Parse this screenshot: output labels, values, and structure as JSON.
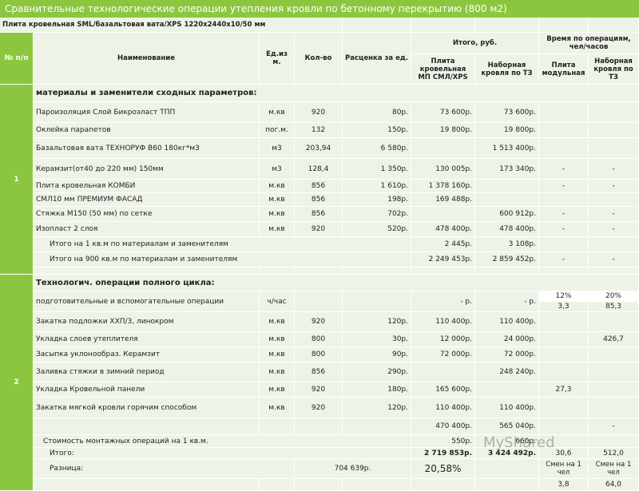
{
  "title": "Сравнительные технологические операции утепления кровли по бетонному перекрытию (800 м2)",
  "subtitle": "Плита кровельная SML/базальтовая вата/XPS 1220x2440x10/50 мм",
  "headers": {
    "num": "№ п/п",
    "name": "Наименование",
    "unit": "Ед.из м.",
    "qty": "Кол-во",
    "price": "Расценка за ед.",
    "total_group": "Итого, руб.",
    "time_group": "Время по операциям, чел/часов",
    "total_sml": "Плита кровельная МП СМЛ/XPS",
    "total_tz": "Наборная кровля по ТЗ",
    "time_mod": "Плита модульная",
    "time_tz": "Наборная кровля по ТЗ"
  },
  "section1": {
    "num": "1",
    "title": "материалы и заменители сходных параметров:",
    "rows": [
      {
        "name": "Пароизоляция Слой Бикроэласт ТПП",
        "unit": "м.кв",
        "qty": "920",
        "price": "80р.",
        "total_sml": "73 600р.",
        "total_tz": "73 600р.",
        "t1": "",
        "t2": ""
      },
      {
        "name": "Оклейка парапетов",
        "unit": "пог.м.",
        "qty": "132",
        "price": "150р.",
        "total_sml": "19 800р.",
        "total_tz": "19 800р.",
        "t1": "",
        "t2": ""
      },
      {
        "name": "Базальтовая вата ТЕХНОРУФ В60 180кг*м3",
        "unit": "м3",
        "qty": "203,94",
        "price": "6 580р.",
        "total_sml": "",
        "total_tz": "1 513 400р.",
        "t1": "",
        "t2": ""
      },
      {
        "name": "Керамзит(от40 до 220 мм) 150мм",
        "unit": "м3",
        "qty": "128,4",
        "price": "1 350р.",
        "total_sml": "130 005р.",
        "total_tz": "173 340р.",
        "t1": "-",
        "t2": "-"
      },
      {
        "name": "Плита кровельная КОМБИ",
        "unit": "м.кв",
        "qty": "856",
        "price": "1 610р.",
        "total_sml": "1 378 160р.",
        "total_tz": "",
        "t1": "-",
        "t2": "-"
      },
      {
        "name": "СМЛ10 мм ПРЕМИУМ ФАСАД",
        "unit": "м.кв",
        "qty": "856",
        "price": "198р.",
        "total_sml": "169 488р.",
        "total_tz": "",
        "t1": "",
        "t2": ""
      },
      {
        "name": "Стяжка М150 (50 мм) по сетке",
        "unit": "м.кв",
        "qty": "856",
        "price": "702р.",
        "total_sml": "",
        "total_tz": "600 912р.",
        "t1": "-",
        "t2": "-"
      },
      {
        "name": "Изопласт 2 слоя",
        "unit": "м.кв",
        "qty": "920",
        "price": "520р.",
        "total_sml": "478 400р.",
        "total_tz": "478 400р.",
        "t1": "-",
        "t2": "-"
      }
    ],
    "sum1": {
      "label": "Итого на 1 кв.м по материалам и заменителям",
      "total_sml": "2 445р.",
      "total_tz": "3 108р."
    },
    "sum2": {
      "label": "Итого на 900 кв.м по материалам и заменителям",
      "total_sml": "2 249 453р.",
      "total_tz": "2 859 452р.",
      "t1": "-",
      "t2": "-"
    }
  },
  "section2": {
    "num": "2",
    "title": "Технологич. операции полного цикла:",
    "prep": {
      "name": "подготовительные и вспомогательные операции",
      "unit": "ч/час",
      "total_sml": "- р.",
      "total_tz": "- р.",
      "pct1": "12%",
      "pct2": "20%",
      "val1": "3,3",
      "val2": "85,3"
    },
    "rows": [
      {
        "name": "Закатка подложки ХХП/3, линокром",
        "unit": "м.кв",
        "qty": "920",
        "price": "120р.",
        "total_sml": "110 400р.",
        "total_tz": "110 400р.",
        "t1": "",
        "t2": ""
      },
      {
        "name": "Укладка слоев утеплителя",
        "unit": "м.кв",
        "qty": "800",
        "price": "30р.",
        "total_sml": "12 000р.",
        "total_tz": "24 000р.",
        "t1": "",
        "t2": "426,7"
      },
      {
        "name": "Засыпка уклонообраз. Керамзит",
        "unit": "м.кв",
        "qty": "800",
        "price": "90р.",
        "total_sml": "72 000р.",
        "total_tz": "72 000р.",
        "t1": "",
        "t2": ""
      },
      {
        "name": "Заливка стяжки в зимний период",
        "unit": "м.кв",
        "qty": "856",
        "price": "290р.",
        "total_sml": "",
        "total_tz": "248 240р.",
        "t1": "",
        "t2": ""
      },
      {
        "name": "Укладка Кровельной панели",
        "unit": "м.кв",
        "qty": "920",
        "price": "180р.",
        "total_sml": "165 600р.",
        "total_tz": "",
        "t1": "27,3",
        "t2": ""
      },
      {
        "name": "Закатка мягкой кровли горячим способом",
        "unit": "м.кв",
        "qty": "920",
        "price": "120р.",
        "total_sml": "110 400р.",
        "total_tz": "110 400р.",
        "t1": "",
        "t2": ""
      }
    ],
    "subtotal": {
      "total_sml": "470 400р.",
      "total_tz": "565 040р.",
      "t2": "-"
    },
    "mount": {
      "label": "Стоимость монтажных операций на 1 кв.м.",
      "total_sml": "550р.",
      "total_tz": "660р."
    },
    "grand": {
      "label": "Итого:",
      "total_sml": "2 719 853р.",
      "total_tz": "3 424 492р.",
      "t1": "30,6",
      "t2": "512,0"
    },
    "diff": {
      "label": "Разница:",
      "amount": "704 639р.",
      "pct": "20,58%",
      "t1": "Смен на 1 чел",
      "t2": "Смен на 1 чел"
    },
    "last": {
      "t1": "3,8",
      "t2": "64,0"
    }
  },
  "watermark": "MyShared"
}
